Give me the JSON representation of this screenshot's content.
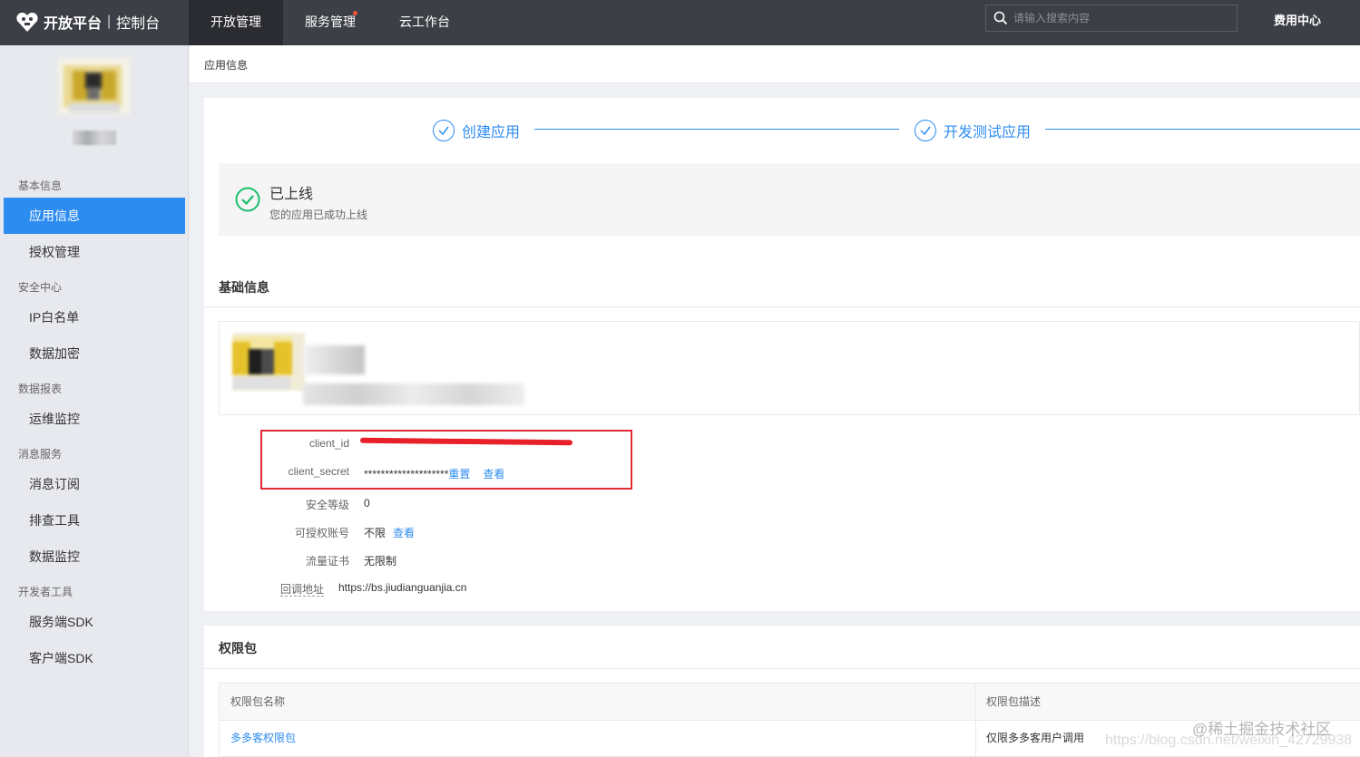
{
  "header": {
    "brand": "开放平台",
    "sub": "控制台",
    "nav": [
      {
        "label": "开放管理",
        "active": true
      },
      {
        "label": "服务管理",
        "badge": true
      },
      {
        "label": "云工作台"
      }
    ],
    "search_placeholder": "请输入搜索内容",
    "fee_center": "费用中心"
  },
  "sidebar": {
    "groups": [
      {
        "title": "基本信息",
        "items": [
          "应用信息",
          "授权管理"
        ]
      },
      {
        "title": "安全中心",
        "items": [
          "IP白名单",
          "数据加密"
        ]
      },
      {
        "title": "数据报表",
        "items": [
          "运维监控"
        ]
      },
      {
        "title": "消息服务",
        "items": [
          "消息订阅",
          "排查工具",
          "数据监控"
        ]
      },
      {
        "title": "开发者工具",
        "items": [
          "服务端SDK",
          "客户端SDK"
        ]
      }
    ],
    "active_item": "应用信息"
  },
  "main": {
    "breadcrumb": "应用信息",
    "steps": [
      "创建应用",
      "开发测试应用"
    ],
    "status": {
      "title": "已上线",
      "desc": "您的应用已成功上线"
    },
    "basic": {
      "title": "基础信息",
      "client_id_label": "client_id",
      "client_secret_label": "client_secret",
      "client_secret_value": "********************",
      "reset": "重置",
      "view": "查看",
      "security_level_label": "安全等级",
      "security_level": "0",
      "auth_accounts_label": "可授权账号",
      "auth_accounts": "不限",
      "auth_accounts_view": "查看",
      "traffic_label": "流量证书",
      "traffic": "无限制",
      "callback_label": "回调地址",
      "callback": "https://bs.jiudianguanjia.cn"
    },
    "permissions": {
      "title": "权限包",
      "columns": [
        "权限包名称",
        "权限包描述"
      ],
      "rows": [
        [
          "多多客权限包",
          "仅限多多客用户调用"
        ]
      ]
    }
  },
  "watermark": {
    "line1": "@稀土掘金技术社区",
    "line2": "https://blog.csdn.net/weixin_42729938"
  },
  "colors": {
    "accent": "#2d8cf0",
    "topbar": "#3c3f45",
    "success": "#19be6b",
    "redbox": "#e02b35"
  }
}
